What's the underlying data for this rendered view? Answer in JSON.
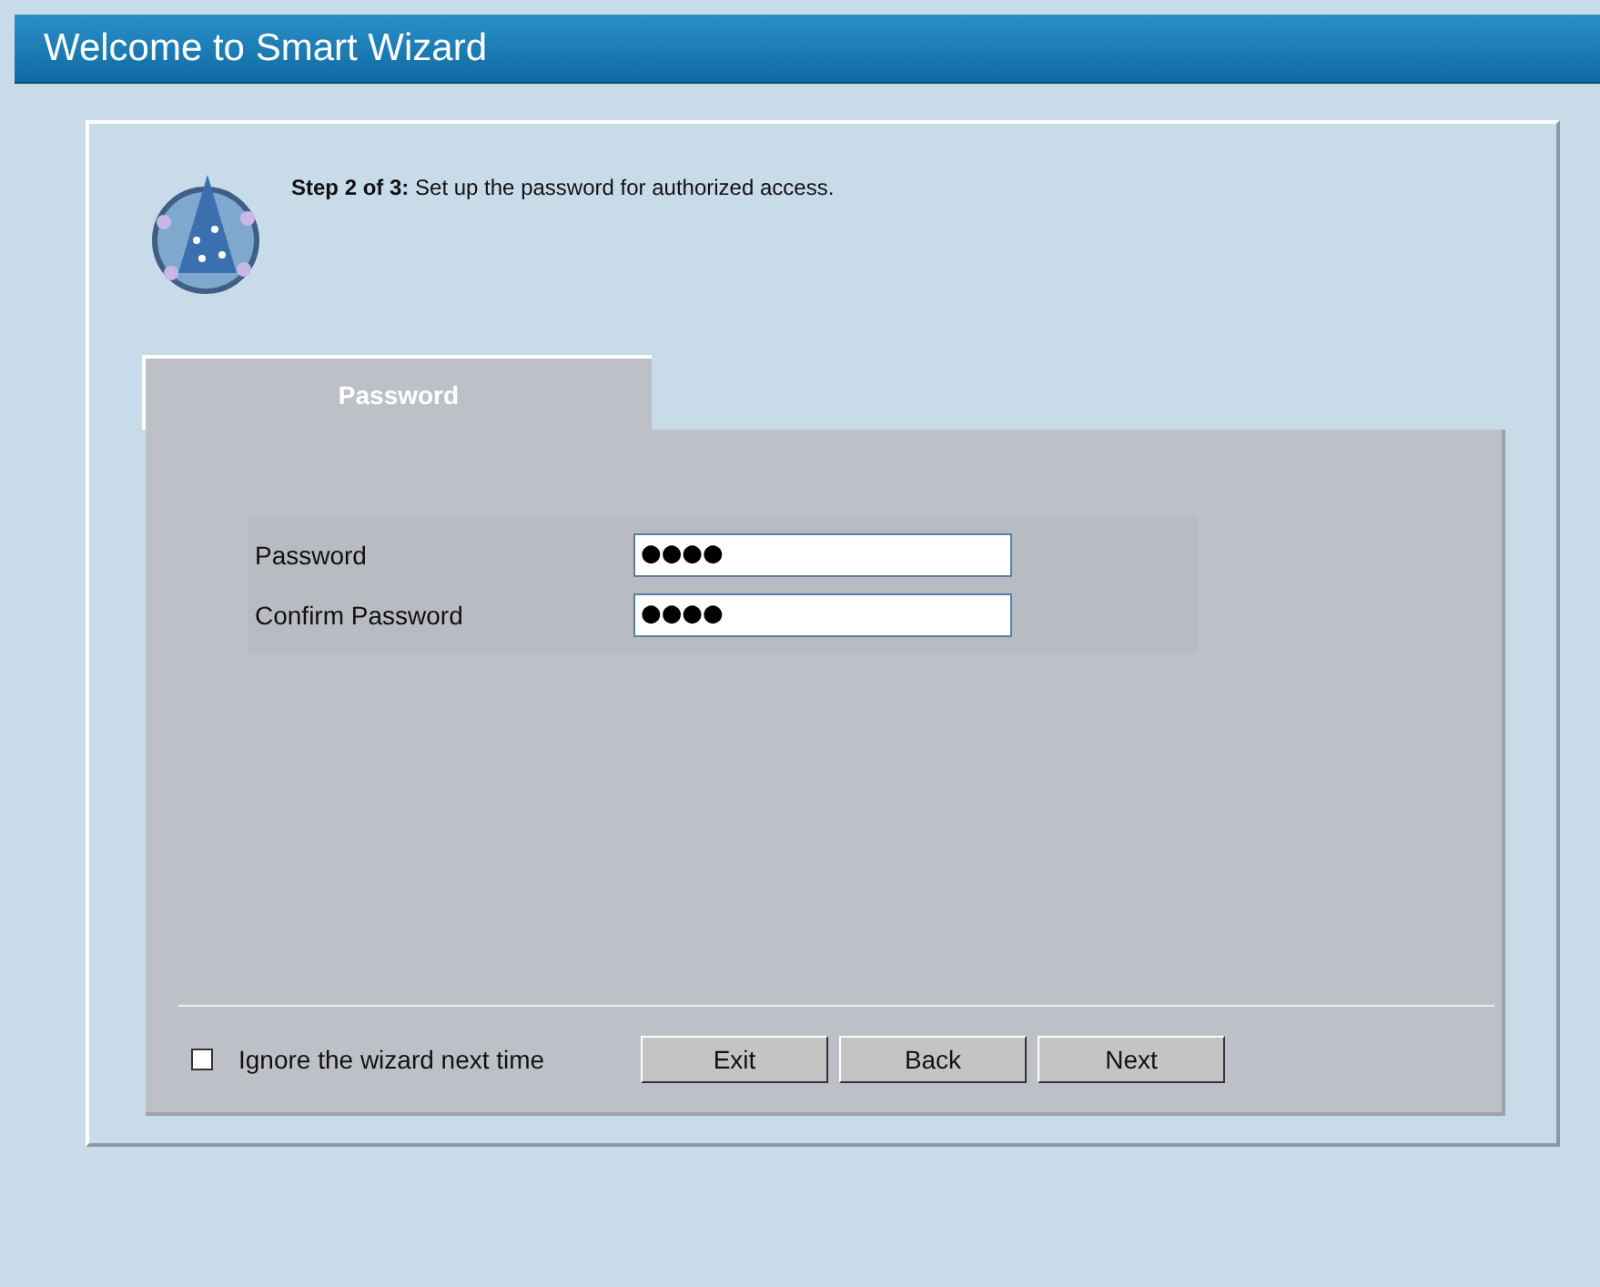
{
  "window": {
    "title": "Welcome to Smart Wizard"
  },
  "step": {
    "label": "Step 2 of 3:",
    "text": "Set up the password for authorized access."
  },
  "tabs": [
    {
      "label": "Password",
      "selected": true
    }
  ],
  "fields": [
    {
      "label": "Password",
      "value": "●●●●"
    },
    {
      "label": "Confirm Password",
      "value": "●●●●"
    }
  ],
  "ignore_wizard": {
    "label": "Ignore the wizard next time",
    "checked": false
  },
  "buttons": [
    "Exit",
    "Back",
    "Next"
  ]
}
